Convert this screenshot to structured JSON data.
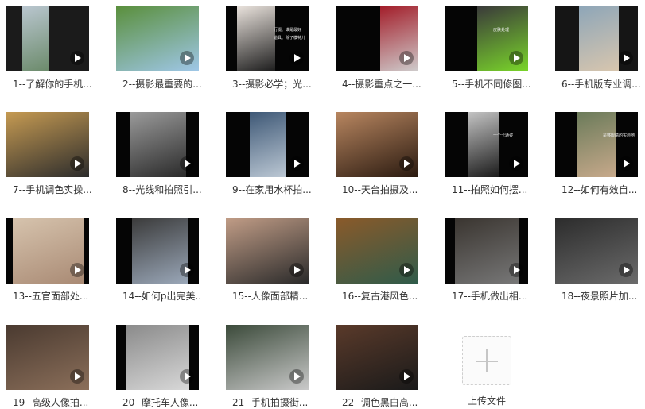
{
  "videos": [
    {
      "label": "1--了解你的手机...",
      "bg": "#1b1b1b",
      "photo": "#b9c6cf",
      "photo_accent": "#6b8a6a",
      "icon": "play-icon"
    },
    {
      "label": "2--摄影最重要的...",
      "bg": "#0c0c0c",
      "photo": "#5a8f3c",
      "photo_accent": "#9fc7e8",
      "icon": "play-icon"
    },
    {
      "label": "3--摄影必学；光...",
      "bg": "#050505",
      "photo": "#e9e2dc",
      "photo_accent": "#1c1c1c",
      "icon": "play-icon",
      "overlay": [
        "行摄、谁是最好",
        "道具、除了模特儿"
      ]
    },
    {
      "label": "4--摄影重点之一...",
      "bg": "#050505",
      "photo": "#a31e2a",
      "photo_accent": "#cfcfcf",
      "icon": "play-icon"
    },
    {
      "label": "5--手机不同修图...",
      "bg": "#050505",
      "photo": "#3a3a3a",
      "photo_accent": "#7ad62a",
      "icon": "play-icon",
      "overlay": [
        "皮肤处理"
      ]
    },
    {
      "label": "6--手机版专业调...",
      "bg": "#151515",
      "photo": "#8ea6b8",
      "photo_accent": "#d8c6ae",
      "icon": "play-icon"
    },
    {
      "label": "7--手机调色实操...",
      "bg": "#5e88b8",
      "photo": "#c59a52",
      "photo_accent": "#2c2c2c",
      "icon": "play-icon"
    },
    {
      "label": "8--光线和拍照引...",
      "bg": "#050505",
      "photo": "#9a9a9a",
      "photo_accent": "#2a2a2a",
      "icon": "play-icon"
    },
    {
      "label": "9--在家用水杯拍...",
      "bg": "#050505",
      "photo": "#3e5876",
      "photo_accent": "#bcc8d4",
      "icon": "play-icon"
    },
    {
      "label": "10--天台拍摄及...",
      "bg": "#3a2a20",
      "photo": "#b88660",
      "photo_accent": "#2a1a10",
      "icon": "play-icon"
    },
    {
      "label": "11--拍照如何摆...",
      "bg": "#050505",
      "photo": "#c4c4c4",
      "photo_accent": "#1a1a1a",
      "icon": "play-icon",
      "overlay": [
        "一个卡通姿"
      ]
    },
    {
      "label": "12--如何有效自...",
      "bg": "#050505",
      "photo": "#6b7b5a",
      "photo_accent": "#c7a98b",
      "icon": "play-icon",
      "overlay": [
        "是够眼睛的实验地"
      ]
    },
    {
      "label": "13--五官面部处...",
      "bg": "#050505",
      "photo": "#d6c3ad",
      "photo_accent": "#a98a74",
      "icon": "play-icon"
    },
    {
      "label": "14--如何p出完美...",
      "bg": "#050505",
      "photo": "#3b3b3b",
      "photo_accent": "#9aa7b8",
      "icon": "play-icon"
    },
    {
      "label": "15--人像面部精...",
      "bg": "#050505",
      "photo": "#c09c86",
      "photo_accent": "#2a2a2a",
      "icon": "play-icon"
    },
    {
      "label": "16--复古港风色...",
      "bg": "#101010",
      "photo": "#8a5a2a",
      "photo_accent": "#2f5b4a",
      "icon": "play-icon"
    },
    {
      "label": "17--手机做出相...",
      "bg": "#050505",
      "photo": "#3a3530",
      "photo_accent": "#777",
      "icon": "play-icon"
    },
    {
      "label": "18--夜景照片加...",
      "bg": "#050505",
      "photo": "#2c2c2c",
      "photo_accent": "#6b6b6b",
      "icon": "play-icon"
    },
    {
      "label": "19--高级人像拍...",
      "bg": "#050505",
      "photo": "#4a3a30",
      "photo_accent": "#8b6f5a",
      "icon": "play-icon"
    },
    {
      "label": "20--摩托车人像...",
      "bg": "#050505",
      "photo": "#8a8a8a",
      "photo_accent": "#d8d8d8",
      "icon": "play-icon"
    },
    {
      "label": "21--手机拍摄街...",
      "bg": "#050505",
      "photo": "#3b4a3a",
      "photo_accent": "#c9c9c9",
      "icon": "play-icon"
    },
    {
      "label": "22--调色黑白高...",
      "bg": "#050505",
      "photo": "#5a3a2a",
      "photo_accent": "#1a1a1a",
      "icon": "play-icon"
    }
  ],
  "add_button": {
    "label": "上传文件",
    "icon": "plus-icon"
  }
}
